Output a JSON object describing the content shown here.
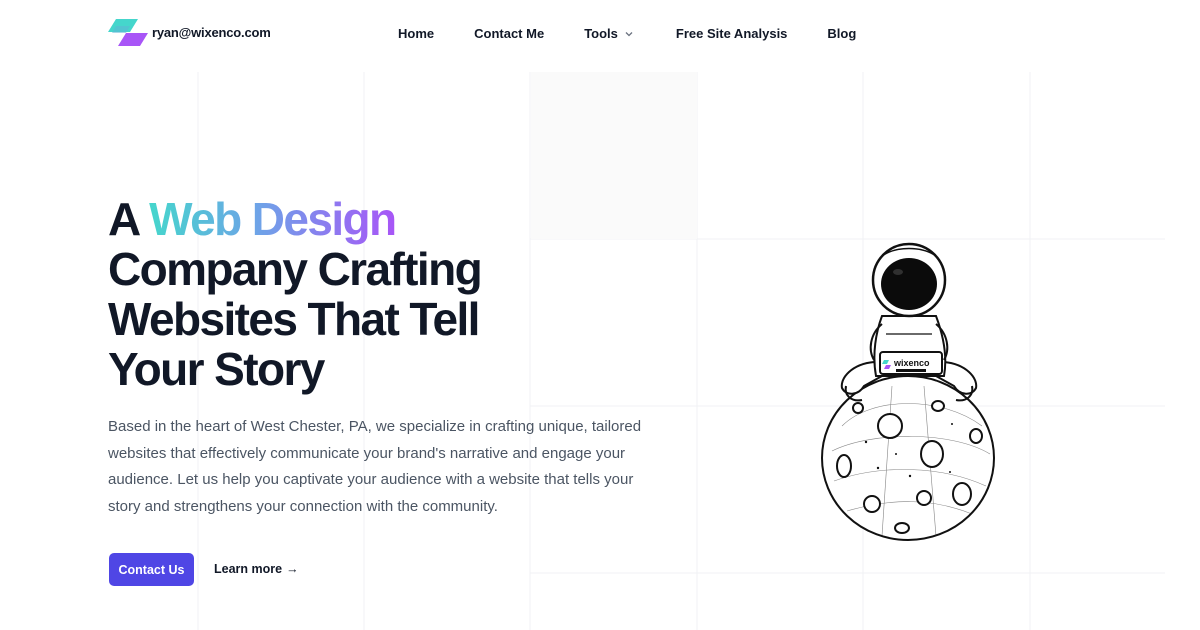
{
  "header": {
    "logo_text": "ryan@wixenco.com",
    "logo_colors": {
      "teal": "#45d6cc",
      "purple": "#a855f7"
    },
    "nav": [
      {
        "label": "Home"
      },
      {
        "label": "Contact Me"
      },
      {
        "label": "Tools",
        "icon": "chevron-down-icon"
      },
      {
        "label": "Free Site Analysis"
      },
      {
        "label": "Blog"
      }
    ]
  },
  "hero": {
    "headline_prefix": "A",
    "headline_highlight": "Web Design",
    "headline_line2": "Company Crafting",
    "headline_line3": "Websites That Tell",
    "headline_line4": "Your Story",
    "description": "Based in the heart of West Chester, PA, we specialize in crafting unique, tailored websites that effectively communicate your brand's narrative and engage your audience. Let us help you captivate your audience with a website that tells your story and strengthens your connection with the community.",
    "primary_button": "Contact Us",
    "secondary_link": "Learn more",
    "secondary_link_icon": "arrow-right-icon",
    "illustration_badge": "wixenco"
  },
  "colors": {
    "primary_button": "#4f46e5",
    "heading": "#111827",
    "body_text": "#4b5563",
    "gradient": [
      "#45d6cc",
      "#6fa2e8",
      "#a855f7"
    ]
  }
}
